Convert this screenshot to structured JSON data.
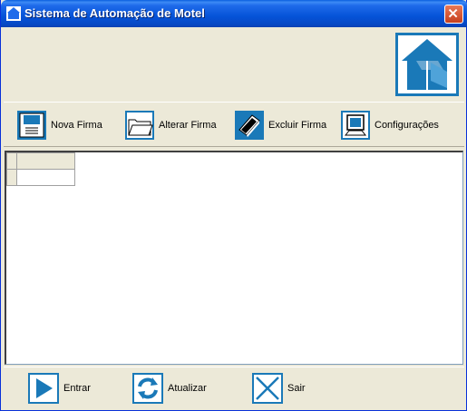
{
  "window": {
    "title": "Sistema de Automação de Motel"
  },
  "toolbar": {
    "nova_firma": "Nova Firma",
    "alterar_firma": "Alterar Firma",
    "excluir_firma": "Excluir Firma",
    "configuracoes": "Configurações"
  },
  "bottom": {
    "entrar": "Entrar",
    "atualizar": "Atualizar",
    "sair": "Sair"
  },
  "colors": {
    "accent": "#1A79B8",
    "title_bar": "#0553D8",
    "close": "#C6401E"
  },
  "icons": [
    "window-app-icon",
    "close-icon",
    "house-logo-icon",
    "floppy-icon",
    "folder-icon",
    "book-delete-icon",
    "monitor-icon",
    "play-arrow-icon",
    "refresh-icon",
    "x-icon"
  ]
}
